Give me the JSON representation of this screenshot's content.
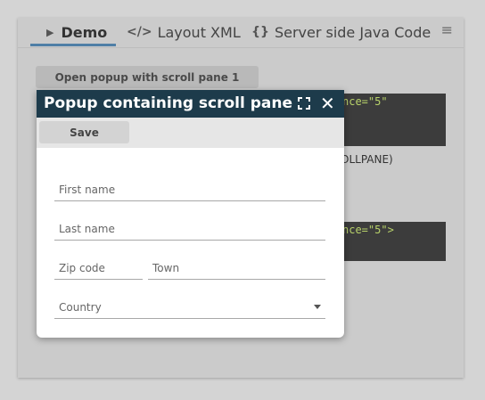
{
  "tabs": [
    {
      "label": "Demo",
      "icon": "play-icon"
    },
    {
      "label": "Layout XML",
      "icon": "code-icon"
    },
    {
      "label": "Server side Java Code",
      "icon": "braces-icon"
    }
  ],
  "open_button_label": "Open popup with scroll pane 1",
  "code_line_1": "nce=\"5\"",
  "code_line_2": "nce=\"5\">",
  "background_text": "OLLPANE)",
  "popup": {
    "title": "Popup containing scroll pane",
    "save_label": "Save",
    "fields": {
      "first_name": "First name",
      "last_name": "Last name",
      "zip": "Zip code",
      "town": "Town",
      "country": "Country"
    }
  },
  "colors": {
    "header": "#1d3b4b",
    "tab_accent": "#4f7fa6",
    "code_bg": "#3c3c3c",
    "code_text": "#b8d26a"
  }
}
